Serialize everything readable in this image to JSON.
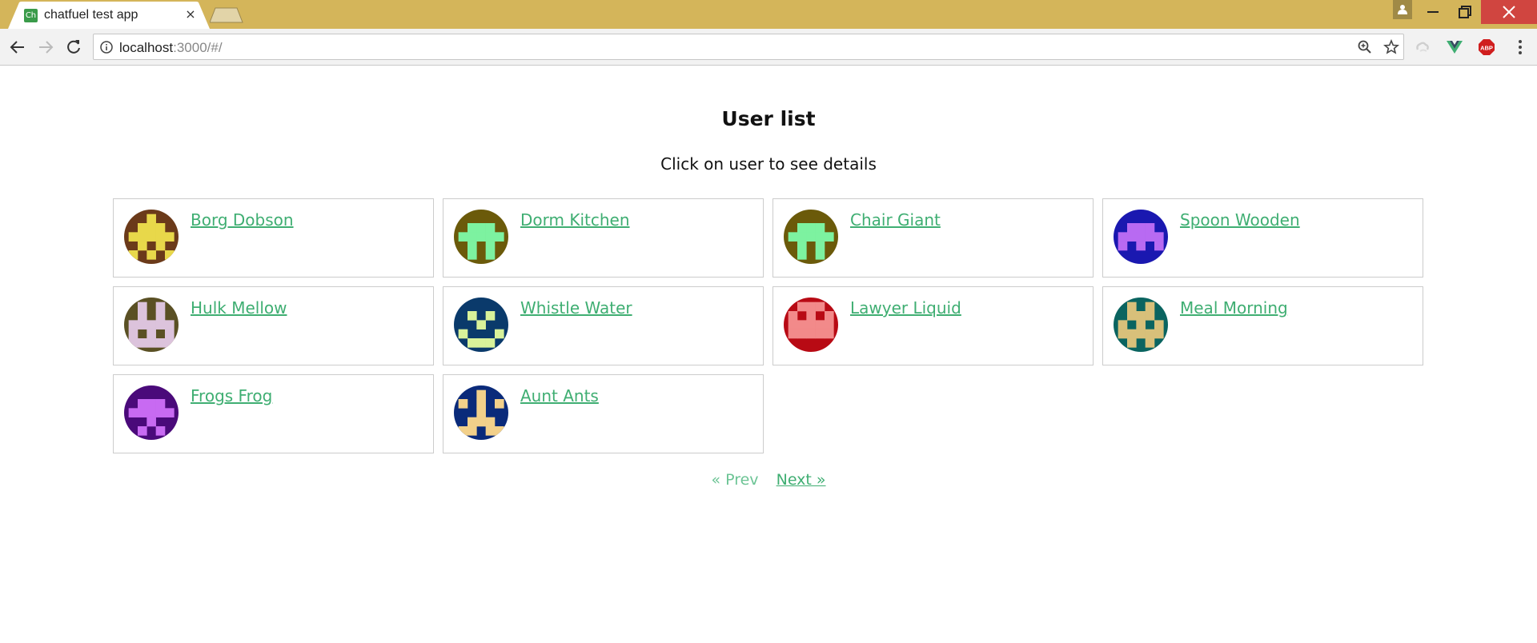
{
  "browser": {
    "tab_title": "chatfuel test app",
    "tab_favicon_text": "Ch",
    "tab_close": "×",
    "url_host": "localhost",
    "url_path": ":3000/#/",
    "extensions": [
      "cloud-sync-icon",
      "vue-devtools-icon",
      "adblock-plus-icon"
    ],
    "ext_abp_label": "ABP"
  },
  "page": {
    "title": "User list",
    "subtitle": "Click on user to see details"
  },
  "users": [
    {
      "name": "Borg Dobson",
      "bg": "#6b3a1a",
      "fg": "#e8d84a",
      "icon": "identicon"
    },
    {
      "name": "Dorm Kitchen",
      "bg": "#6b5a0a",
      "fg": "#7df2a0",
      "icon": "identicon"
    },
    {
      "name": "Chair Giant",
      "bg": "#6b5a0a",
      "fg": "#7df2a0",
      "icon": "identicon"
    },
    {
      "name": "Spoon Wooden",
      "bg": "#1a18b0",
      "fg": "#b86af2",
      "icon": "identicon"
    },
    {
      "name": "Hulk Mellow",
      "bg": "#5a5024",
      "fg": "#dcc3dc",
      "icon": "identicon"
    },
    {
      "name": "Whistle Water",
      "bg": "#0a3a6b",
      "fg": "#d8f29a",
      "icon": "identicon"
    },
    {
      "name": "Lawyer Liquid",
      "bg": "#b80a14",
      "fg": "#f28a8a",
      "icon": "identicon"
    },
    {
      "name": "Meal Morning",
      "bg": "#0a6460",
      "fg": "#d8c07a",
      "icon": "identicon"
    },
    {
      "name": "Frogs Frog",
      "bg": "#4a0a7a",
      "fg": "#c86af2",
      "icon": "identicon"
    },
    {
      "name": "Aunt Ants",
      "bg": "#0a2a7a",
      "fg": "#f2d08a",
      "icon": "identicon"
    }
  ],
  "pager": {
    "prev": "« Prev",
    "next": "Next »"
  },
  "colors": {
    "link": "#3fae72",
    "link_disabled": "#6cc495",
    "titlebar": "#d4b55a"
  }
}
